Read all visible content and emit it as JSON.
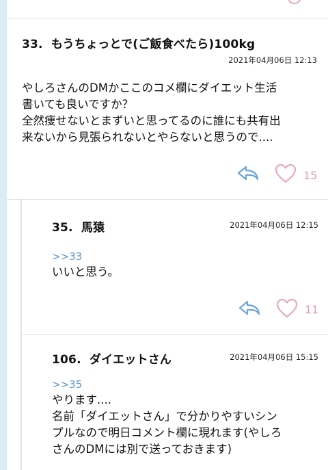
{
  "comments": [
    {
      "number": "33.",
      "name": "もうちょっとで(ご飯食べたら)100kg",
      "date": "2021年04月06日 12:13",
      "body": "やしろさんのDMかここのコメ欄にダイエット生活\n書いても良いですか？\n全然痩せないとまずいと思ってるのに誰にも共有出\n来ないから見張られないとやらないと思うので....",
      "likes": "15"
    },
    {
      "number": "35.",
      "name": "馬猿",
      "date": "2021年04月06日 12:15",
      "anchor": ">>33",
      "body": "いいと思う。",
      "likes": "11"
    },
    {
      "number": "106.",
      "name": "ダイエットさん",
      "date": "2021年04月06日 15:15",
      "anchor": ">>35",
      "body": "やります....\n名前「ダイエットさん」で分かりやすいシン\nプルなので明日コメント欄に現れます(やしろ\nさんのDMには別で送っておきます)"
    }
  ],
  "icons": {
    "reply": "reply-arrow-icon",
    "like": "heart-icon"
  },
  "colors": {
    "reply_icon": "#6aa6d8",
    "heart_icon": "#e8a9b8",
    "like_count": "#e59aaf",
    "anchor_link": "#5b97d6",
    "left_rail": "#d9ecf7"
  }
}
